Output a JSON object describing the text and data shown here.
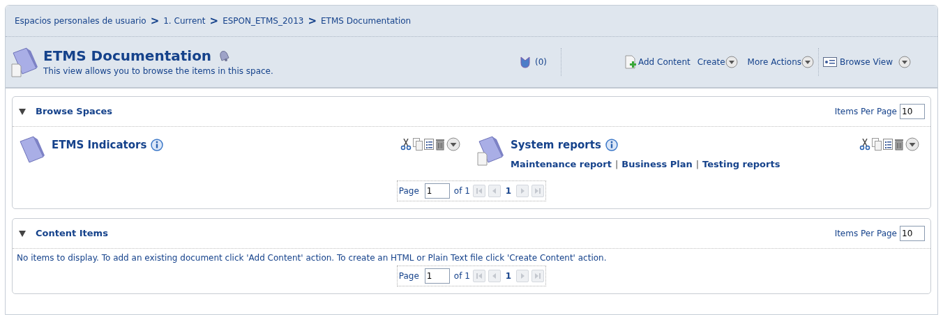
{
  "breadcrumb": [
    {
      "kind": "link",
      "text": "Espacios personales de usuario"
    },
    {
      "kind": "separator",
      "text": ">"
    },
    {
      "kind": "link",
      "text": "1. Current"
    },
    {
      "kind": "separator",
      "text": ">"
    },
    {
      "kind": "link",
      "text": "ESPON_ETMS_2013"
    },
    {
      "kind": "separator",
      "text": ">"
    },
    {
      "kind": "link",
      "text": "ETMS Documentation"
    }
  ],
  "header": {
    "title": "ETMS Documentation",
    "description": "This view allows you to browse the items in this space.",
    "count": "(0)",
    "actions": [
      {
        "kind": "add",
        "label": "Add Content"
      },
      {
        "kind": "menu",
        "label": "Create"
      },
      {
        "kind": "menu",
        "label": "More Actions"
      },
      {
        "kind": "view",
        "label": "Browse View"
      }
    ]
  },
  "panels": [
    {
      "kind": "spaces",
      "title": "Browse Spaces",
      "expanded": true,
      "items_per_page_label": "Items Per Page",
      "items_per_page": "10",
      "spaces": [
        {
          "name": "ETMS Indicators"
        },
        {
          "name": "System reports",
          "links": [
            {
              "kind": "link",
              "text": "Maintenance report"
            },
            {
              "kind": "separator",
              "text": "|"
            },
            {
              "kind": "link",
              "text": "Business Plan"
            },
            {
              "kind": "separator",
              "text": "|"
            },
            {
              "kind": "link",
              "text": "Testing reports"
            }
          ]
        }
      ],
      "pager": {
        "label": "Page",
        "page": "1",
        "of": "of 1",
        "current": "1",
        "disabled": true
      }
    },
    {
      "kind": "content",
      "title": "Content Items",
      "expanded": true,
      "items_per_page_label": "Items Per Page",
      "items_per_page": "10",
      "message": "No items to display. To add an existing document click 'Add Content' action. To create an HTML or Plain Text file click 'Create Content' action.",
      "pager": {
        "label": "Page",
        "page": "1",
        "of": "of 1",
        "current": "1",
        "disabled": true
      }
    }
  ]
}
